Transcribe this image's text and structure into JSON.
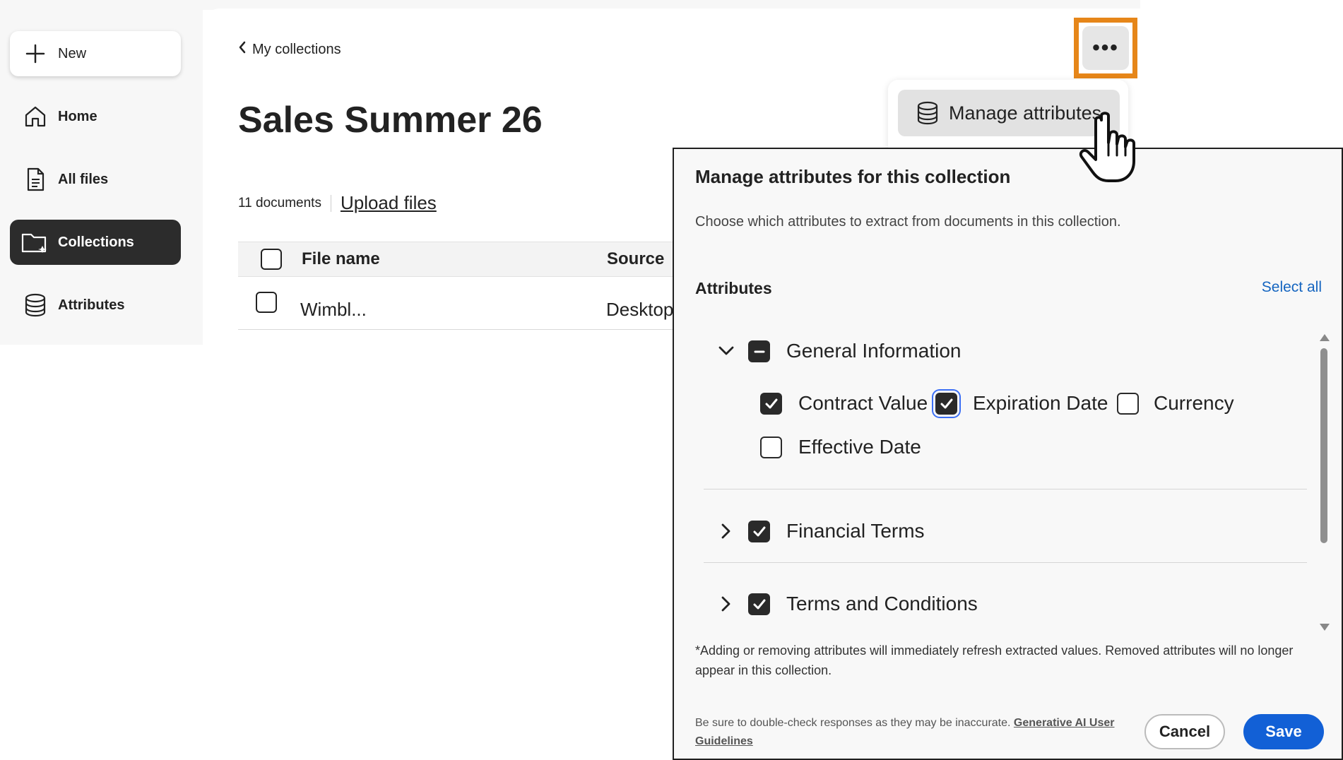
{
  "sidebar": {
    "items": [
      {
        "label": "New",
        "icon": "plus-icon"
      },
      {
        "label": "Home",
        "icon": "home-icon"
      },
      {
        "label": "All files",
        "icon": "document-icon"
      },
      {
        "label": "Collections",
        "icon": "folder-icon"
      },
      {
        "label": "Attributes",
        "icon": "database-icon"
      }
    ]
  },
  "breadcrumb": {
    "label": "My collections"
  },
  "page": {
    "title": "Sales Summer 26",
    "doc_count": "11 documents",
    "upload_label": "Upload files"
  },
  "table": {
    "headers": [
      "File name",
      "Source"
    ],
    "rows": [
      {
        "name": "Wimbl...",
        "source": "Desktop"
      }
    ]
  },
  "menu": {
    "more_label": "•••",
    "items": [
      {
        "label": "Manage attributes",
        "icon": "database-icon"
      }
    ]
  },
  "dialog": {
    "title": "Manage attributes for this collection",
    "description": "Choose which attributes to extract from documents in this collection.",
    "attributes_label": "Attributes",
    "select_all": "Select all",
    "groups": [
      {
        "label": "General Information",
        "state": "partial",
        "expanded": true,
        "items": [
          {
            "label": "Contract Value",
            "checked": true
          },
          {
            "label": "Expiration Date",
            "checked": true
          },
          {
            "label": "Currency",
            "checked": false
          },
          {
            "label": "Effective Date",
            "checked": false
          }
        ]
      },
      {
        "label": "Financial Terms",
        "state": "checked",
        "expanded": false
      },
      {
        "label": "Terms and Conditions",
        "state": "checked",
        "expanded": false
      }
    ],
    "note": "*Adding or removing attributes will immediately refresh extracted values. Removed attributes will no longer appear in this collection.",
    "disclaimer": "Be sure to double-check responses as they may be inaccurate.",
    "guidelines_link": "Generative AI User Guidelines",
    "cancel_label": "Cancel",
    "save_label": "Save"
  },
  "colors": {
    "accent": "#1260d6",
    "highlight": "#e68619",
    "selected_nav": "#2c2c2c"
  }
}
